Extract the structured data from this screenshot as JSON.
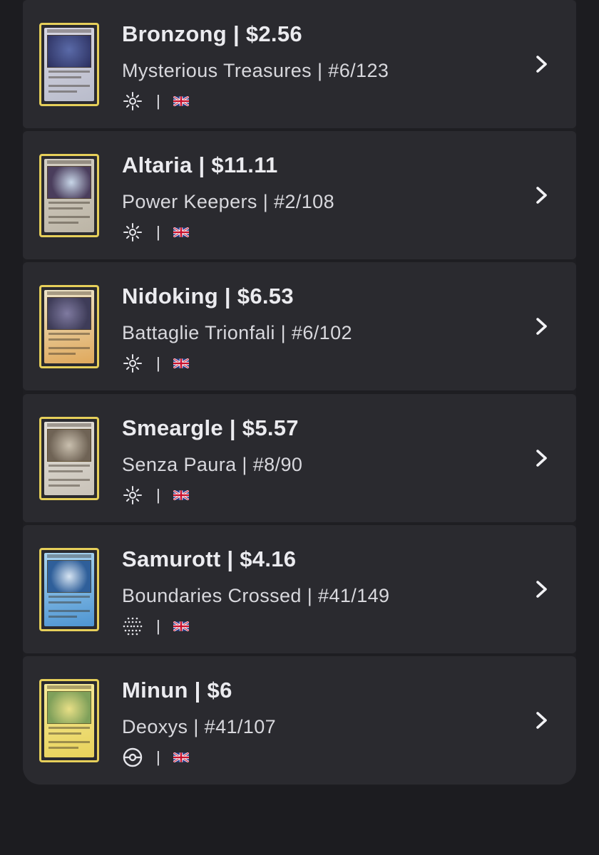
{
  "cards": [
    {
      "name_price": "Bronzong | $2.56",
      "set_number": "Mysterious Treasures | #6/123",
      "rarity_icon": "holo-sparkle-icon",
      "separator": "|",
      "language_icon": "uk-flag-icon",
      "card_colors": [
        "#3d4b7a",
        "#c9c8d5"
      ]
    },
    {
      "name_price": "Altaria | $11.11",
      "set_number": "Power Keepers | #2/108",
      "rarity_icon": "holo-sparkle-icon",
      "separator": "|",
      "language_icon": "uk-flag-icon",
      "card_colors": [
        "#5a4a6e",
        "#cfc7b8"
      ]
    },
    {
      "name_price": "Nidoking | $6.53",
      "set_number": "Battaglie Trionfali | #6/102",
      "rarity_icon": "holo-sparkle-icon",
      "separator": "|",
      "language_icon": "uk-flag-icon",
      "card_colors": [
        "#6a6882",
        "#e2b26a"
      ]
    },
    {
      "name_price": "Smeargle | $5.57",
      "set_number": "Senza Paura | #8/90",
      "rarity_icon": "holo-sparkle-icon",
      "separator": "|",
      "language_icon": "uk-flag-icon",
      "card_colors": [
        "#9a8a78",
        "#d9d4cc"
      ]
    },
    {
      "name_price": "Samurott | $4.16",
      "set_number": "Boundaries Crossed | #41/149",
      "rarity_icon": "dotted-grid-icon",
      "separator": "|",
      "language_icon": "uk-flag-icon",
      "card_colors": [
        "#3e78b8",
        "#8cc4e8"
      ]
    },
    {
      "name_price": "Minun | $6",
      "set_number": "Deoxys | #41/107",
      "rarity_icon": "pokeball-icon",
      "separator": "|",
      "language_icon": "uk-flag-icon",
      "card_colors": [
        "#9fb86a",
        "#f1e27a"
      ]
    }
  ],
  "colors": {
    "background": "#1c1c20",
    "row_background": "#2a2a2f",
    "title_text": "#ebebef",
    "subtitle_text": "#d8d8dd",
    "card_border": "#e6cf5a"
  }
}
